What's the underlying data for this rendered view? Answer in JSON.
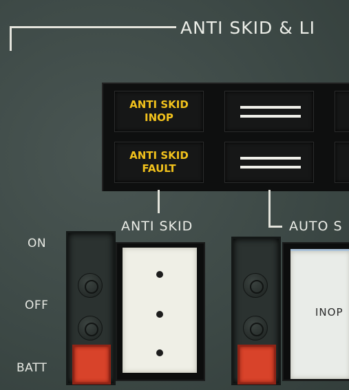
{
  "panel": {
    "section_title": "ANTI SKID & LI"
  },
  "annunciators": {
    "anti_skid_inop": "ANTI SKID\nINOP",
    "anti_skid_fault": "ANTI SKID\nFAULT"
  },
  "switches": {
    "anti_skid_label": "ANTI SKID",
    "auto_skid_label": "AUTO S",
    "positions": [
      "ON",
      "OFF",
      "BATT"
    ],
    "auto_switch_face": "INOP"
  },
  "colors": {
    "panel": "#3e4a47",
    "annunciator_amber": "#f2c21c",
    "guard_red": "#d8432a"
  }
}
